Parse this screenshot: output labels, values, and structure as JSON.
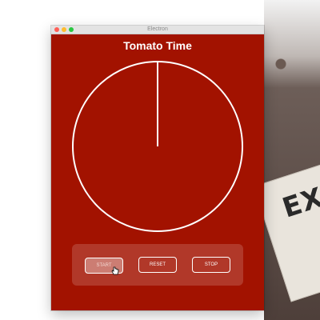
{
  "window": {
    "title": "Electron",
    "background_color": "#a21200"
  },
  "app": {
    "title": "Tomato Time"
  },
  "clock": {
    "face_color": "#a21200",
    "stroke_color": "#ffffff",
    "hand_position": "12 o'clock"
  },
  "controls": {
    "start_label": "START",
    "reset_label": "RESET",
    "stop_label": "STOP"
  },
  "desktop": {
    "paper_text": "EX"
  },
  "icons": {
    "cursor": "hand-pointer-icon",
    "close": "close-icon",
    "minimize": "minimize-icon",
    "zoom": "zoom-icon"
  }
}
